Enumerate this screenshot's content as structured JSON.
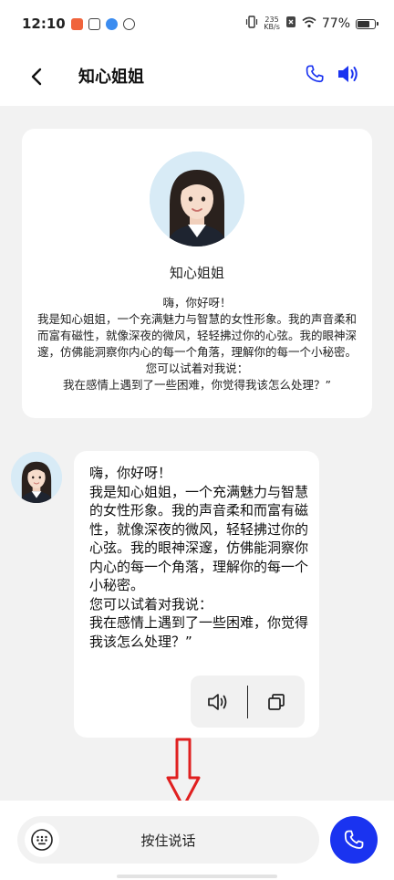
{
  "status_bar": {
    "time": "12:10",
    "net_speed_value": "235",
    "net_speed_unit": "KB/s",
    "battery": "77%",
    "battery_level": 0.77
  },
  "header": {
    "title": "知心姐姐",
    "back_icon": "chevron-left-icon",
    "call_icon": "phone-icon",
    "speaker_icon": "speaker-icon",
    "accent_color": "#1a33f0"
  },
  "intro_card": {
    "name": "知心姐姐",
    "text": "嗨，你好呀！\n我是知心姐姐，一个充满魅力与智慧的女性形象。我的声音柔和而富有磁性，就像深夜的微风，轻轻拂过你的心弦。我的眼神深邃，仿佛能洞察你内心的每一个角落，理解你的每一个小秘密。\n您可以试着对我说：\n我在感情上遇到了一些困难，你觉得我该怎么处理？”"
  },
  "message": {
    "text": "嗨，你好呀！\n我是知心姐姐，一个充满魅力与智慧的女性形象。我的声音柔和而富有磁性，就像深夜的微风，轻轻拂过你的心弦。我的眼神深邃，仿佛能洞察你内心的每一个角落，理解你的每一个小秘密。\n 您可以试着对我说：\n我在感情上遇到了一些困难，你觉得我该怎么处理？”",
    "play_icon": "speaker-outline-icon",
    "copy_icon": "copy-icon"
  },
  "bottom_bar": {
    "voice_button_label": "按住说话",
    "keyboard_icon": "keyboard-icon",
    "call_icon": "phone-icon"
  }
}
